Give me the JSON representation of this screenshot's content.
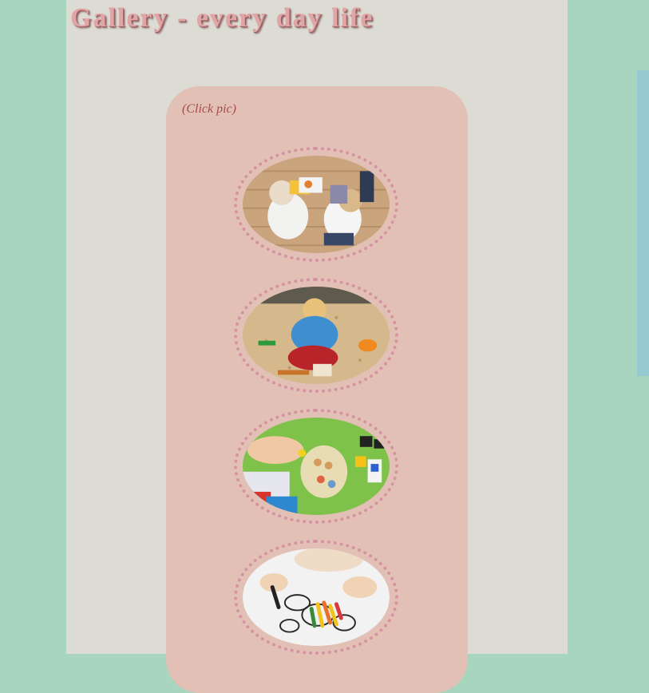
{
  "page": {
    "title": "Gallery - every day life",
    "click_hint": "(Click pic)"
  },
  "gallery": {
    "items": [
      {
        "icon": "photo-children-reading-books"
      },
      {
        "icon": "photo-child-playing-in-sandbox"
      },
      {
        "icon": "photo-children-playing-with-toys"
      },
      {
        "icon": "photo-children-drawing-with-crayons"
      }
    ]
  },
  "colors": {
    "background": "#a8d5bd",
    "column": "#dcdbd4",
    "panel": "#e2c0b6",
    "title": "#e2a4a5",
    "hint": "#a44c4c",
    "thumb_border": "#d592a0",
    "side_strip": "#95cad3"
  }
}
